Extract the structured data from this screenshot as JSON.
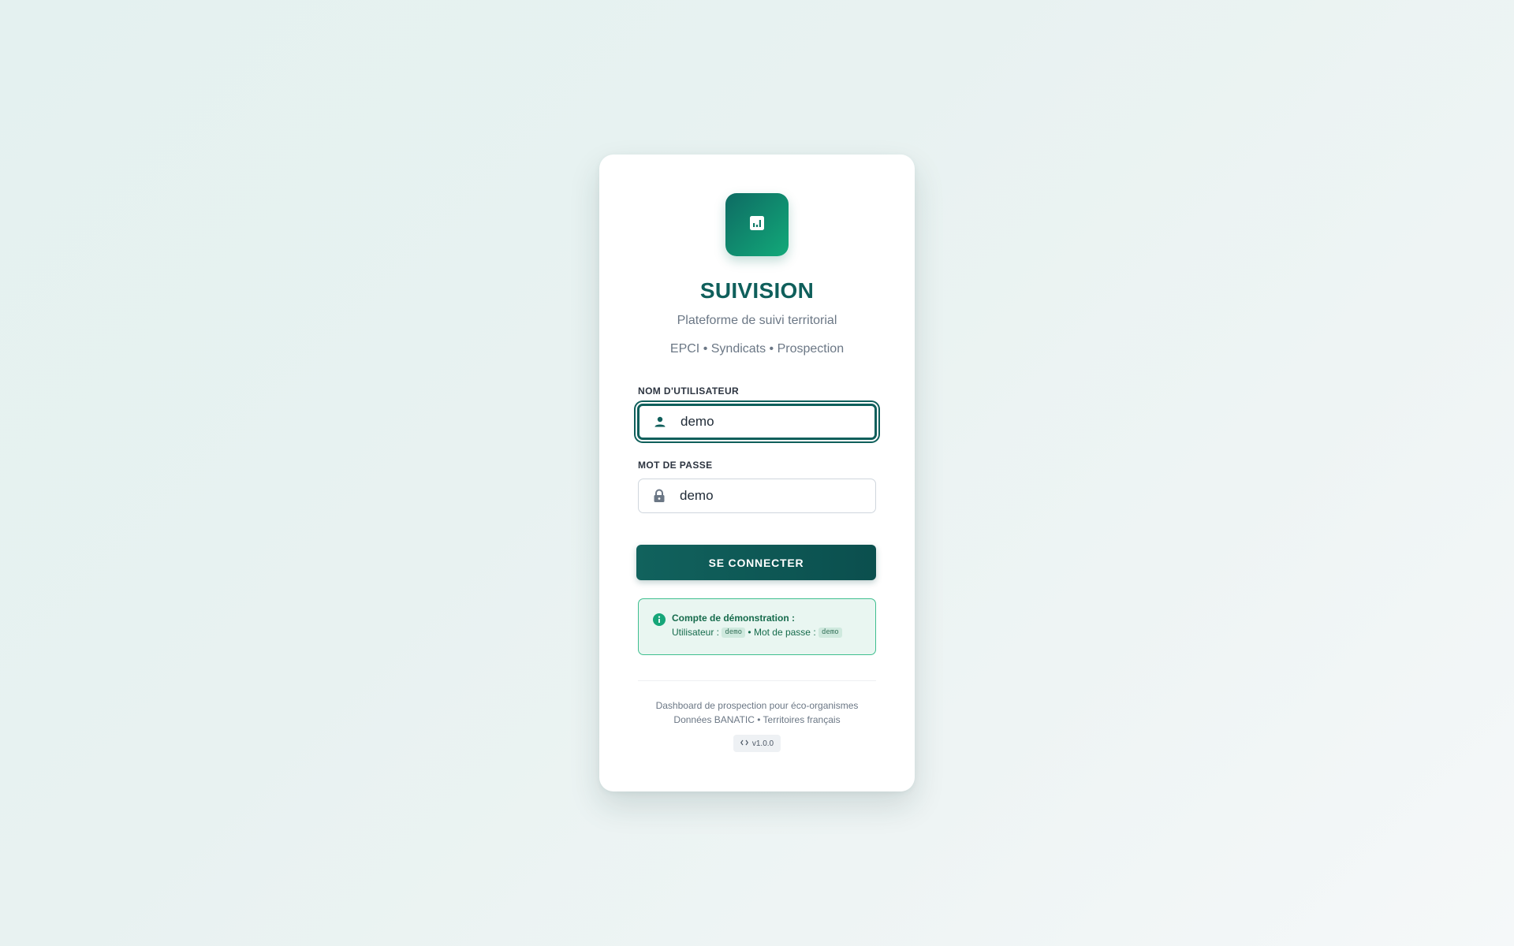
{
  "app": {
    "title": "SUIVISION",
    "subtitle": "Plateforme de suivi territorial",
    "tagline": "EPCI • Syndicats • Prospection",
    "logo_icon": "bar-chart-icon"
  },
  "form": {
    "username_label": "NOM D'UTILISATEUR",
    "username_value": "demo",
    "username_icon": "user-icon",
    "password_label": "MOT DE PASSE",
    "password_value": "demo",
    "password_icon": "lock-icon",
    "submit_label": "SE CONNECTER"
  },
  "demo_info": {
    "icon": "info-icon",
    "heading": "Compte de démonstration :",
    "user_prefix": "Utilisateur :",
    "user_value": "demo",
    "separator": "• Mot de passe :",
    "password_value": "demo"
  },
  "footer": {
    "line1": "Dashboard de prospection pour éco-organismes",
    "line2": "Données BANATIC • Territoires français",
    "version_icon": "code-icon",
    "version": "v1.0.0"
  },
  "colors": {
    "primary": "#0f5f5b",
    "accent": "#12a979",
    "info_border": "#3fbf8f",
    "info_bg": "#e9f6f1"
  }
}
